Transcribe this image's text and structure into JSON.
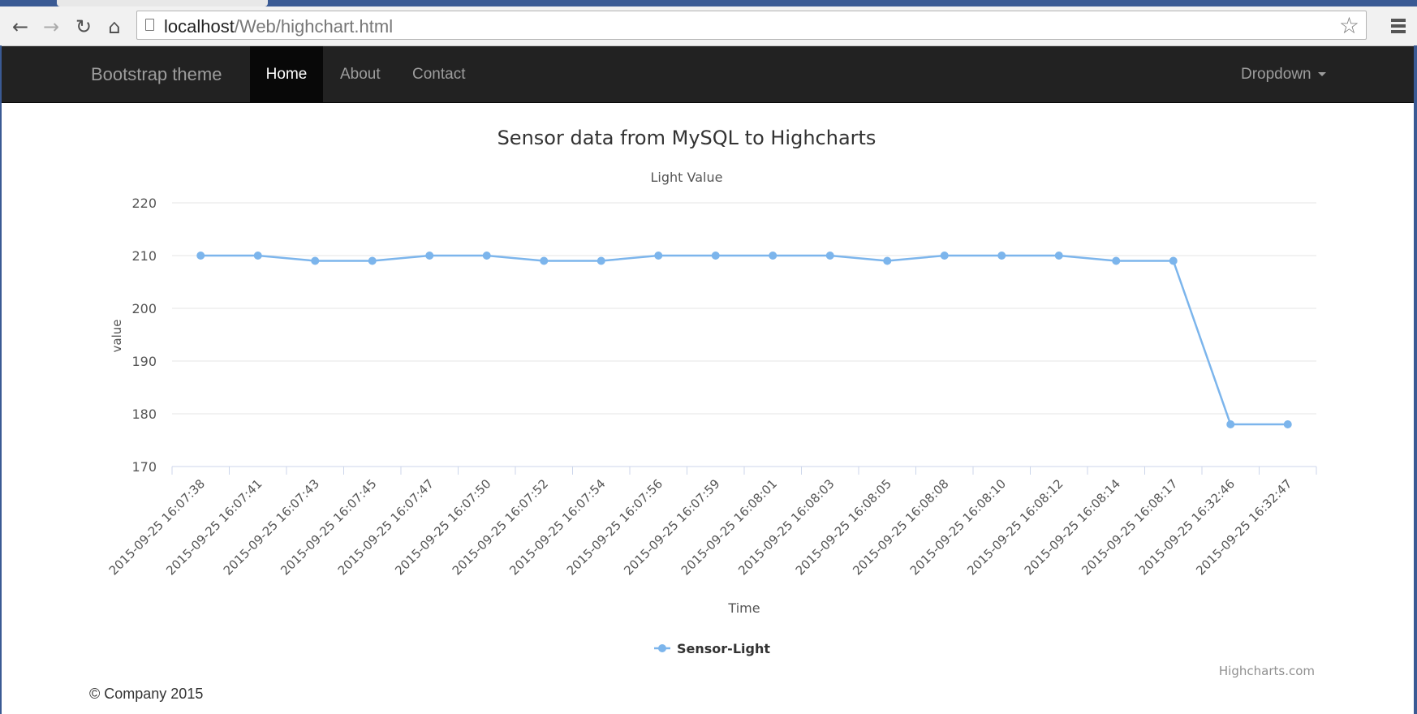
{
  "browser": {
    "url_host": "localhost",
    "url_path": "/Web/highchart.html",
    "back_icon": "back-arrow-icon",
    "forward_icon": "forward-arrow-icon",
    "reload_icon": "reload-icon",
    "home_icon": "home-icon",
    "bookmark_icon": "star-icon",
    "menu_icon": "hamburger-menu-icon"
  },
  "navbar": {
    "brand": "Bootstrap theme",
    "items": [
      {
        "label": "Home",
        "active": true
      },
      {
        "label": "About",
        "active": false
      },
      {
        "label": "Contact",
        "active": false
      }
    ],
    "dropdown_label": "Dropdown"
  },
  "chart_data": {
    "type": "line",
    "title": "Sensor data from MySQL to Highcharts",
    "subtitle": "Light Value",
    "xlabel": "Time",
    "ylabel": "value",
    "ylim": [
      170,
      220
    ],
    "yticks": [
      170,
      180,
      190,
      200,
      210,
      220
    ],
    "grid": true,
    "legend": "bottom-center",
    "credits": "Highcharts.com",
    "color": "#7cb5ec",
    "categories": [
      "2015-09-25 16:07:38",
      "2015-09-25 16:07:41",
      "2015-09-25 16:07:43",
      "2015-09-25 16:07:45",
      "2015-09-25 16:07:47",
      "2015-09-25 16:07:50",
      "2015-09-25 16:07:52",
      "2015-09-25 16:07:54",
      "2015-09-25 16:07:56",
      "2015-09-25 16:07:59",
      "2015-09-25 16:08:01",
      "2015-09-25 16:08:03",
      "2015-09-25 16:08:05",
      "2015-09-25 16:08:08",
      "2015-09-25 16:08:10",
      "2015-09-25 16:08:12",
      "2015-09-25 16:08:14",
      "2015-09-25 16:08:17",
      "2015-09-25 16:32:46",
      "2015-09-25 16:32:47"
    ],
    "series": [
      {
        "name": "Sensor-Light",
        "values": [
          210,
          210,
          209,
          209,
          210,
          210,
          209,
          209,
          210,
          210,
          210,
          210,
          209,
          210,
          210,
          210,
          209,
          209,
          178,
          178
        ]
      }
    ]
  },
  "footer": {
    "text": "© Company 2015"
  }
}
